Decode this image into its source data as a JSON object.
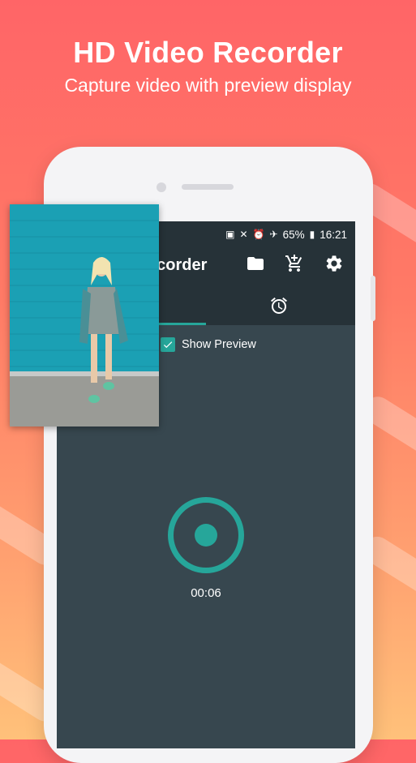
{
  "promo": {
    "headline": "HD Video Recorder",
    "subline": "Capture video with preview display"
  },
  "status_bar": {
    "battery_percent": "65%",
    "time": "16:21",
    "icons": [
      "battery-saver-icon",
      "vibrate-icon",
      "alarm-icon",
      "airplane-icon",
      "battery-icon"
    ]
  },
  "app_bar": {
    "title_visible": "ecorder",
    "actions": [
      "folder-icon",
      "cart-icon",
      "settings-icon"
    ]
  },
  "tabs": {
    "selected_index": 0,
    "items": [
      "record-tab",
      "alarm-clock-icon"
    ]
  },
  "options": {
    "show_preview_label": "Show Preview",
    "show_preview_checked": true
  },
  "recorder": {
    "elapsed": "00:06"
  },
  "colors": {
    "accent": "#26a69a",
    "appbar": "#263238",
    "screen_bg": "#37474f",
    "gradient_top": "#ff6567",
    "gradient_bottom": "#ffc17a"
  }
}
